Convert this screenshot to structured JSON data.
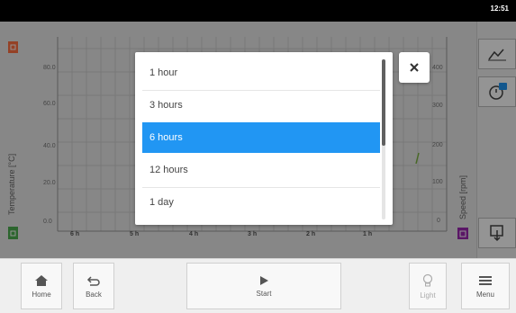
{
  "status_bar": {
    "time": "12:51"
  },
  "plot": {
    "y_left_title": "Temperature [°C]",
    "y_right_title": "Speed [rpm]",
    "y_left_ticks": [
      "80.0",
      "60.0",
      "40.0",
      "20.0",
      "0.0"
    ],
    "y_right_ticks": [
      "400",
      "300",
      "200",
      "100",
      "0"
    ],
    "x_ticks": [
      "6 h",
      "5 h",
      "4 h",
      "3 h",
      "2 h",
      "1 h"
    ]
  },
  "dialog": {
    "options": [
      {
        "label": "1 hour",
        "selected": false
      },
      {
        "label": "3 hours",
        "selected": false
      },
      {
        "label": "6 hours",
        "selected": true
      },
      {
        "label": "12 hours",
        "selected": false
      },
      {
        "label": "1 day",
        "selected": false
      }
    ],
    "close_icon": "close-icon"
  },
  "right_panel": {
    "icons": [
      "chart-icon",
      "timer-settings-icon",
      "export-icon"
    ]
  },
  "bottom_bar": {
    "home_label": "Home",
    "back_label": "Back",
    "start_label": "Start",
    "light_label": "Light",
    "menu_label": "Menu"
  },
  "colors": {
    "selected": "#2196F3",
    "overlay": "#000000",
    "temp_indicator": "#4caf50",
    "speed_indicator": "#9c27b0",
    "temp_top_indicator": "#ff7043"
  }
}
